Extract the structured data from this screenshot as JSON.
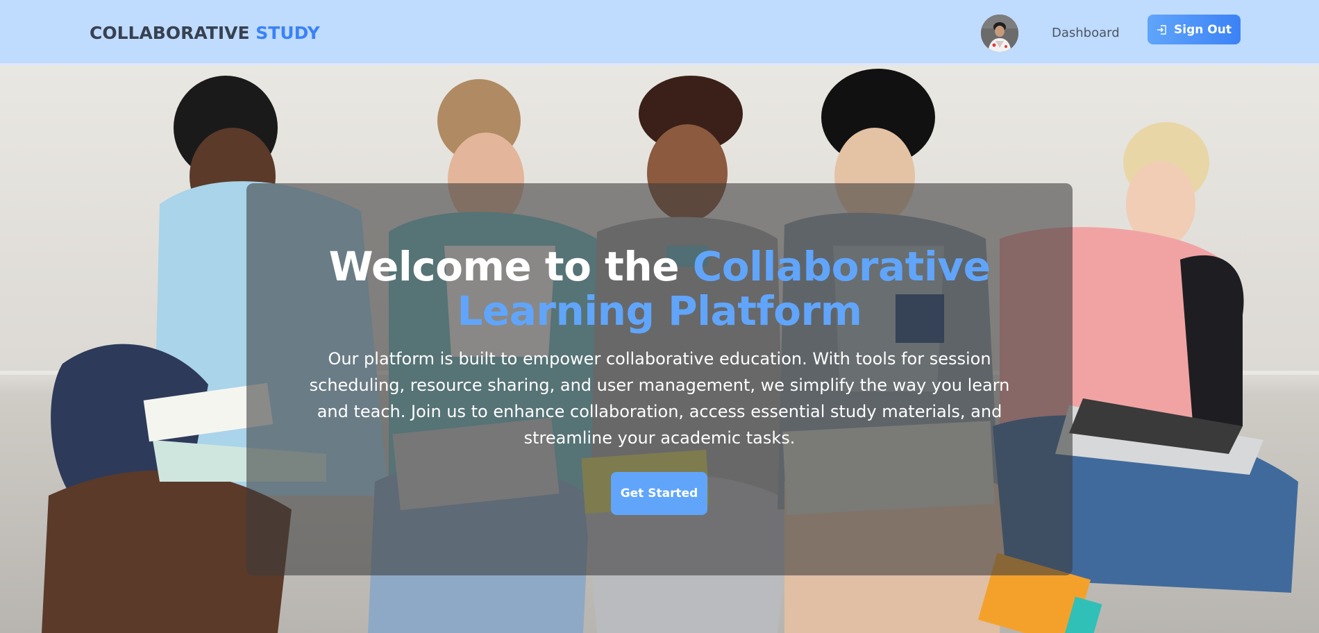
{
  "header": {
    "brand_part1": "COLLABORATIVE",
    "brand_part2": "STUDY",
    "dashboard_link": "Dashboard",
    "signout_label": "Sign Out"
  },
  "hero": {
    "title_part1": "Welcome to the",
    "title_accent": "Collaborative Learning Platform",
    "description": "Our platform is built to empower collaborative education. With tools for session scheduling, resource sharing, and user management, we simplify the way you learn and teach. Join us to enhance collaboration, access essential study materials, and streamline your academic tasks.",
    "cta_label": "Get Started"
  },
  "icons": {
    "avatar": "user-avatar-photo",
    "signout": "sign-out-icon"
  },
  "colors": {
    "navbar_bg": "#bfdbfe",
    "brand_text": "#374151",
    "accent": "#3b82f6",
    "accent_light": "#60a5fa",
    "overlay": "rgba(60,60,60,0.58)"
  }
}
